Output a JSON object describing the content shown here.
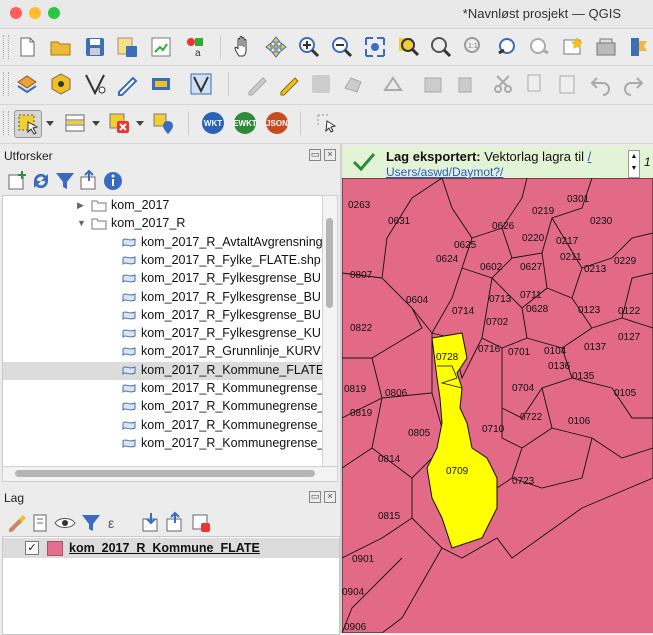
{
  "window": {
    "title": "*Navnløst prosjekt — QGIS"
  },
  "icons": {
    "toolbar1": [
      "new-project-icon",
      "open-project-icon",
      "save-project-icon",
      "save-as-icon",
      "print-layout-icon",
      "style-manager-icon",
      "pan-hand-icon",
      "pan-to-selection-icon",
      "zoom-in-icon",
      "zoom-out-icon",
      "zoom-full-icon",
      "zoom-to-selection-icon",
      "zoom-to-layer-icon",
      "zoom-native-icon",
      "zoom-last-icon",
      "zoom-next-icon",
      "new-bookmark-icon",
      "show-bookmarks-icon",
      "refresh-icon"
    ],
    "toolbar2": [
      "data-source-manager-icon",
      "new-geopackage-layer-icon",
      "digitize-vertex-icon",
      "calculator-icon",
      "processing-toolbox-icon",
      "vector-geometry-icon",
      "current-edits-icon",
      "toggle-editing-icon",
      "save-edits-icon",
      "add-feature-icon",
      "vertex-tool-icon",
      "delete-selected-icon",
      "cut-features-icon",
      "copy-features-icon",
      "paste-features-icon",
      "undo-icon",
      "redo-icon"
    ],
    "toolbar3": [
      "select-features-icon",
      "attribute-table-icon",
      "deselect-all-icon",
      "select-by-location-icon",
      "wkt-icon",
      "ewkt-icon",
      "json-icon",
      "identify-icon"
    ]
  },
  "toolbar3_badges": {
    "wkt": "WKT",
    "ewkt": "EWKT",
    "json": "JSON"
  },
  "browser": {
    "title": "Utforsker",
    "items": [
      {
        "label": "kom_2017",
        "type": "folder",
        "expanded": false
      },
      {
        "label": "kom_2017_R",
        "type": "folder",
        "expanded": true
      },
      {
        "label": "kom_2017_R_AvtaltAvgrensning",
        "type": "file"
      },
      {
        "label": "kom_2017_R_Fylke_FLATE.shp",
        "type": "file"
      },
      {
        "label": "kom_2017_R_Fylkesgrense_BU",
        "type": "file"
      },
      {
        "label": "kom_2017_R_Fylkesgrense_BU",
        "type": "file"
      },
      {
        "label": "kom_2017_R_Fylkesgrense_BU",
        "type": "file"
      },
      {
        "label": "kom_2017_R_Fylkesgrense_KU",
        "type": "file"
      },
      {
        "label": "kom_2017_R_Grunnlinje_KURV",
        "type": "file"
      },
      {
        "label": "kom_2017_R_Kommune_FLATE",
        "type": "file",
        "selected": true
      },
      {
        "label": "kom_2017_R_Kommunegrense_",
        "type": "file"
      },
      {
        "label": "kom_2017_R_Kommunegrense_",
        "type": "file"
      },
      {
        "label": "kom_2017_R_Kommunegrense_",
        "type": "file"
      },
      {
        "label": "kom_2017_R_Kommunegrense_",
        "type": "file"
      }
    ]
  },
  "layers": {
    "title": "Lag",
    "items": [
      {
        "name": "kom_2017_R_Kommune_FLATE",
        "checked": true,
        "color": "#e0708c"
      }
    ]
  },
  "message": {
    "title": "Lag eksportert:",
    "text": "Vektorlag lagra til",
    "link_suffix": "/",
    "link": "Users/aswd/Daymot?/",
    "counter": "1"
  },
  "map": {
    "fill_color": "#e26a86",
    "highlight_color": "#ffff00",
    "labels": [
      "0263",
      "0301",
      "0219",
      "0230",
      "0631",
      "0626",
      "0220",
      "0217",
      "0625",
      "0211",
      "0229",
      "0624",
      "0602",
      "0627",
      "0213",
      "0807",
      "0713",
      "0711",
      "0604",
      "0628",
      "0123",
      "0122",
      "0714",
      "0702",
      "0822",
      "0728",
      "0137",
      "0127",
      "0716",
      "0701",
      "0104",
      "0136",
      "0135",
      "0819",
      "0806",
      "0704",
      "0105",
      "0722",
      "0106",
      "0819",
      "0710",
      "0805",
      "0814",
      "0709",
      "0723",
      "0815",
      "0901",
      "0904",
      "0906"
    ],
    "selected_labels": [
      "0728",
      "0710",
      "0709"
    ]
  }
}
